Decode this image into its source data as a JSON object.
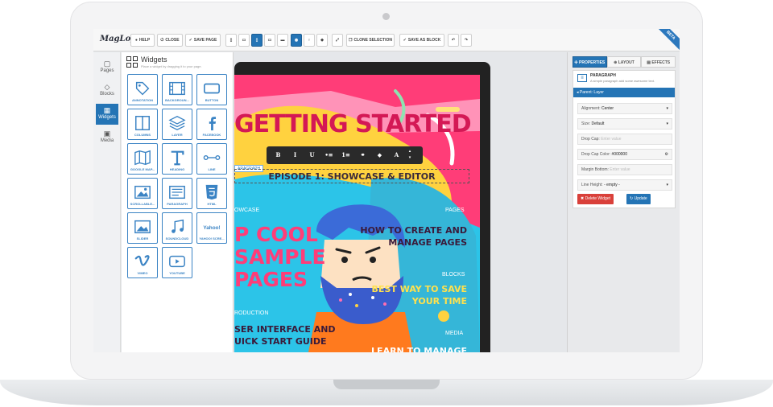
{
  "app": {
    "logo": "MagLoft",
    "beta_badge": "BETA"
  },
  "toolbar": {
    "help": "HELP",
    "close": "CLOSE",
    "save_page": "SAVE PAGE",
    "clone_selection": "CLONE SELECTION",
    "save_as_block": "SAVE AS BLOCK"
  },
  "rail": [
    {
      "label": "Pages",
      "icon": "pages-icon",
      "active": false
    },
    {
      "label": "Blocks",
      "icon": "blocks-icon",
      "active": false
    },
    {
      "label": "Widgets",
      "icon": "widgets-icon",
      "active": true
    },
    {
      "label": "Media",
      "icon": "media-icon",
      "active": false
    }
  ],
  "widgets": {
    "title": "Widgets",
    "subtitle": "Place a widget by dragging it to your page.",
    "items": [
      {
        "label": "ANNOTATION",
        "icon": "tag-icon"
      },
      {
        "label": "BACKGROUN...",
        "icon": "film-icon"
      },
      {
        "label": "BUTTON",
        "icon": "button-icon"
      },
      {
        "label": "COLUMNS",
        "icon": "columns-icon"
      },
      {
        "label": "LAYER",
        "icon": "layers-icon"
      },
      {
        "label": "FACEBOOK",
        "icon": "facebook-icon"
      },
      {
        "label": "GOOGLE MAP...",
        "icon": "map-icon"
      },
      {
        "label": "HEADING",
        "icon": "heading-icon"
      },
      {
        "label": "LINE",
        "icon": "line-icon"
      },
      {
        "label": "SCROLLABLE...",
        "icon": "image-icon"
      },
      {
        "label": "PARAGRAPH",
        "icon": "paragraph-icon"
      },
      {
        "label": "HTML",
        "icon": "html5-icon"
      },
      {
        "label": "SLIDER",
        "icon": "slider-icon"
      },
      {
        "label": "SOUNDCLOUD",
        "icon": "music-icon"
      },
      {
        "label": "YAHOO! SCRE...",
        "icon": "yahoo-icon"
      },
      {
        "label": "VIMEO",
        "icon": "vimeo-icon"
      },
      {
        "label": "YOUTUBE",
        "icon": "youtube-icon"
      }
    ]
  },
  "canvas": {
    "title": "GETTING STARTED",
    "episode": "EPISODE 1: SHOWCASE & EDITOR",
    "paragraph_tag": "ARAGRAPH",
    "format_buttons": [
      "B",
      "I",
      "U",
      "•≡",
      "1≡",
      "⚭",
      "◆",
      "A"
    ],
    "labels": {
      "showcase": "OWCASE",
      "pages": "PAGES",
      "blocks": "BLOCKS",
      "introduction": "RODUCTION",
      "media": "MEDIA"
    },
    "big_left": [
      "P COOL",
      "SAMPLE",
      "PAGES"
    ],
    "how_to": [
      "HOW TO CREATE AND",
      "MANAGE PAGES"
    ],
    "best_way": [
      "BEST WAY TO SAVE",
      "YOUR TIME"
    ],
    "user_interface": [
      "SER INTERFACE AND",
      "UICK START GUIDE"
    ],
    "learn": "LEARN TO MANAGE"
  },
  "properties": {
    "tabs": [
      "PROPERTIES",
      "LAYOUT",
      "EFFECTS"
    ],
    "element_title": "PARAGRAPH",
    "element_desc": "A simple paragraph add some awesome text.",
    "parent": "Parent: Layer",
    "fields": [
      {
        "label": "Alignment:",
        "value": "Center",
        "kind": "select"
      },
      {
        "label": "Size:",
        "value": "Default",
        "kind": "select"
      },
      {
        "label": "Drop Cap:",
        "placeholder": "Enter value",
        "kind": "input"
      },
      {
        "label": "Drop Cap Color:",
        "value": "#000000",
        "kind": "color"
      },
      {
        "label": "Margin Bottom:",
        "placeholder": "Enter value",
        "kind": "input"
      },
      {
        "label": "Line Height:",
        "value": "- empty -",
        "kind": "select"
      }
    ],
    "delete_label": "Delete Widget",
    "update_label": "Update",
    "colors": {
      "accent": "#2474b5",
      "delete": "#d9403a"
    }
  }
}
